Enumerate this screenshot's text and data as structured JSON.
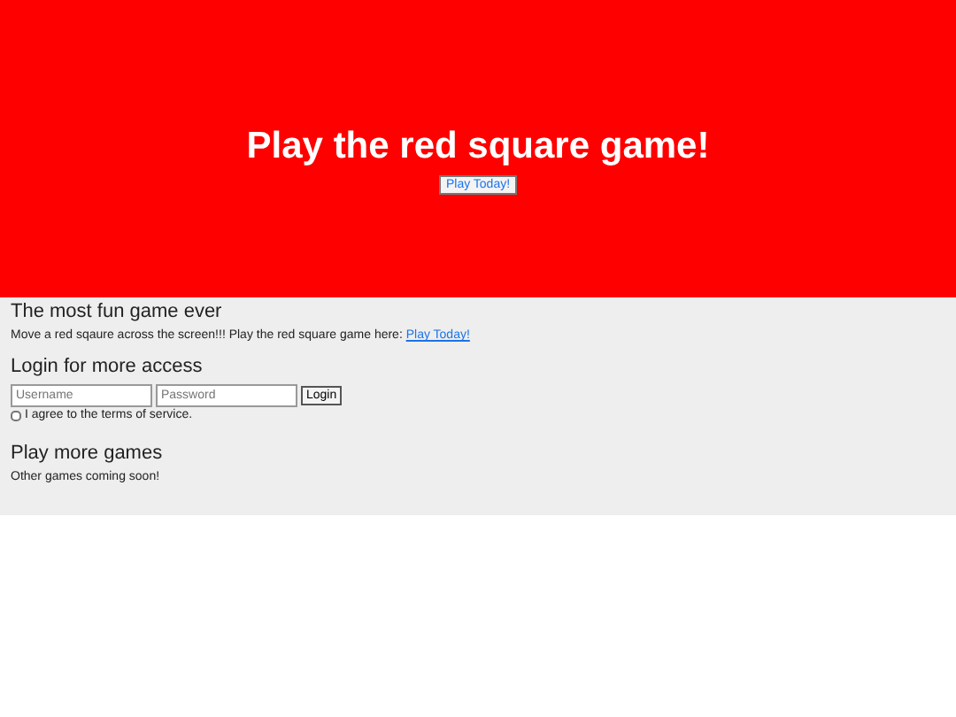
{
  "hero": {
    "title": "Play the red square game!",
    "button": "Play Today!"
  },
  "sections": [
    {
      "kind": "text",
      "heading": "The most fun game ever",
      "text": "Move a red sqaure across the screen!!! Play the red square game here: ",
      "link": "Play Today!"
    },
    {
      "kind": "login",
      "heading": "Login for more access",
      "username_placeholder": "Username",
      "password_placeholder": "Password",
      "button": "Login",
      "terms": {
        "label": "I agree to the terms of service.",
        "checked": false
      }
    },
    {
      "kind": "text",
      "heading": "Play more games",
      "text": "Other games coming soon!"
    }
  ]
}
